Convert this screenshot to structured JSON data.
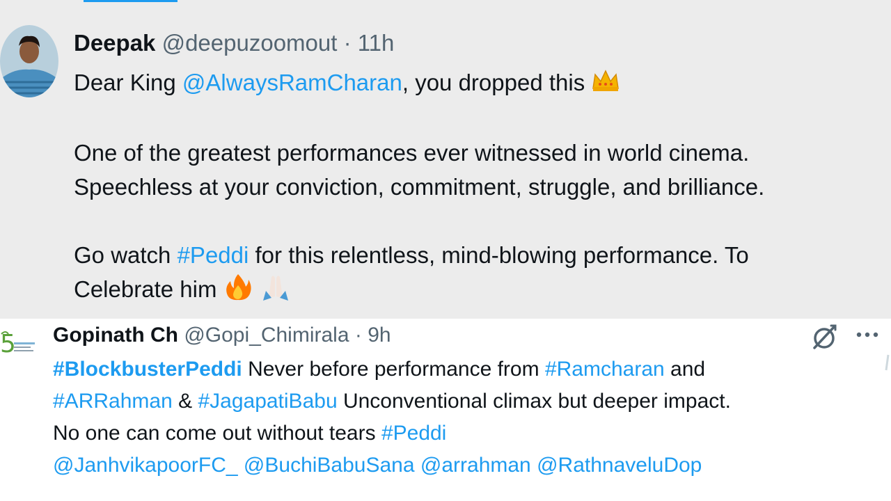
{
  "tweet1": {
    "author_name": "Deepak",
    "handle": "@deepuzoomout",
    "separator": "·",
    "time": "11h",
    "line1_prefix": "Dear King ",
    "line1_mention": "@AlwaysRamCharan",
    "line1_suffix": ", you dropped this ",
    "para2_line1": "One of the greatest performances ever witnessed in world cinema.",
    "para2_line2": "Speechless at your conviction, commitment, struggle, and brilliance.",
    "para3_prefix": "Go watch ",
    "para3_hashtag": "#Peddi",
    "para3_suffix": " for this relentless, mind-blowing performance. To",
    "para3_line2": "Celebrate him ",
    "emojis": [
      "crown-icon",
      "fire-icon",
      "folded-hands-icon"
    ]
  },
  "tweet2": {
    "author_name": "Gopinath Ch",
    "handle": "@Gopi_Chimirala",
    "separator": "·",
    "time": "9h",
    "l1_hashtag": "#BlockbusterPeddi",
    "l1_text": " Never before performance from ",
    "l1_hashtag2": "#Ramcharan",
    "l1_text2": " and",
    "l2_hashtag": "#ARRahman",
    "l2_text": " & ",
    "l2_hashtag2": "#JagapatiBabu",
    "l2_text2": " Unconventional climax but deeper impact.",
    "l3_text": "No one can come out without tears ",
    "l3_hashtag": "#Peddi",
    "mentions": [
      "@JanhvikapoorFC_",
      "@BuchiBabuSana",
      "@arrahman",
      "@RathnaveluDop"
    ],
    "icons": [
      "grok-icon",
      "more-icon"
    ]
  },
  "colors": {
    "link": "#1d9bf0",
    "secondary_text": "#536471",
    "primary_text": "#0f1419",
    "tweet1_bg": "#ececec",
    "tweet2_bg": "#ffffff"
  }
}
